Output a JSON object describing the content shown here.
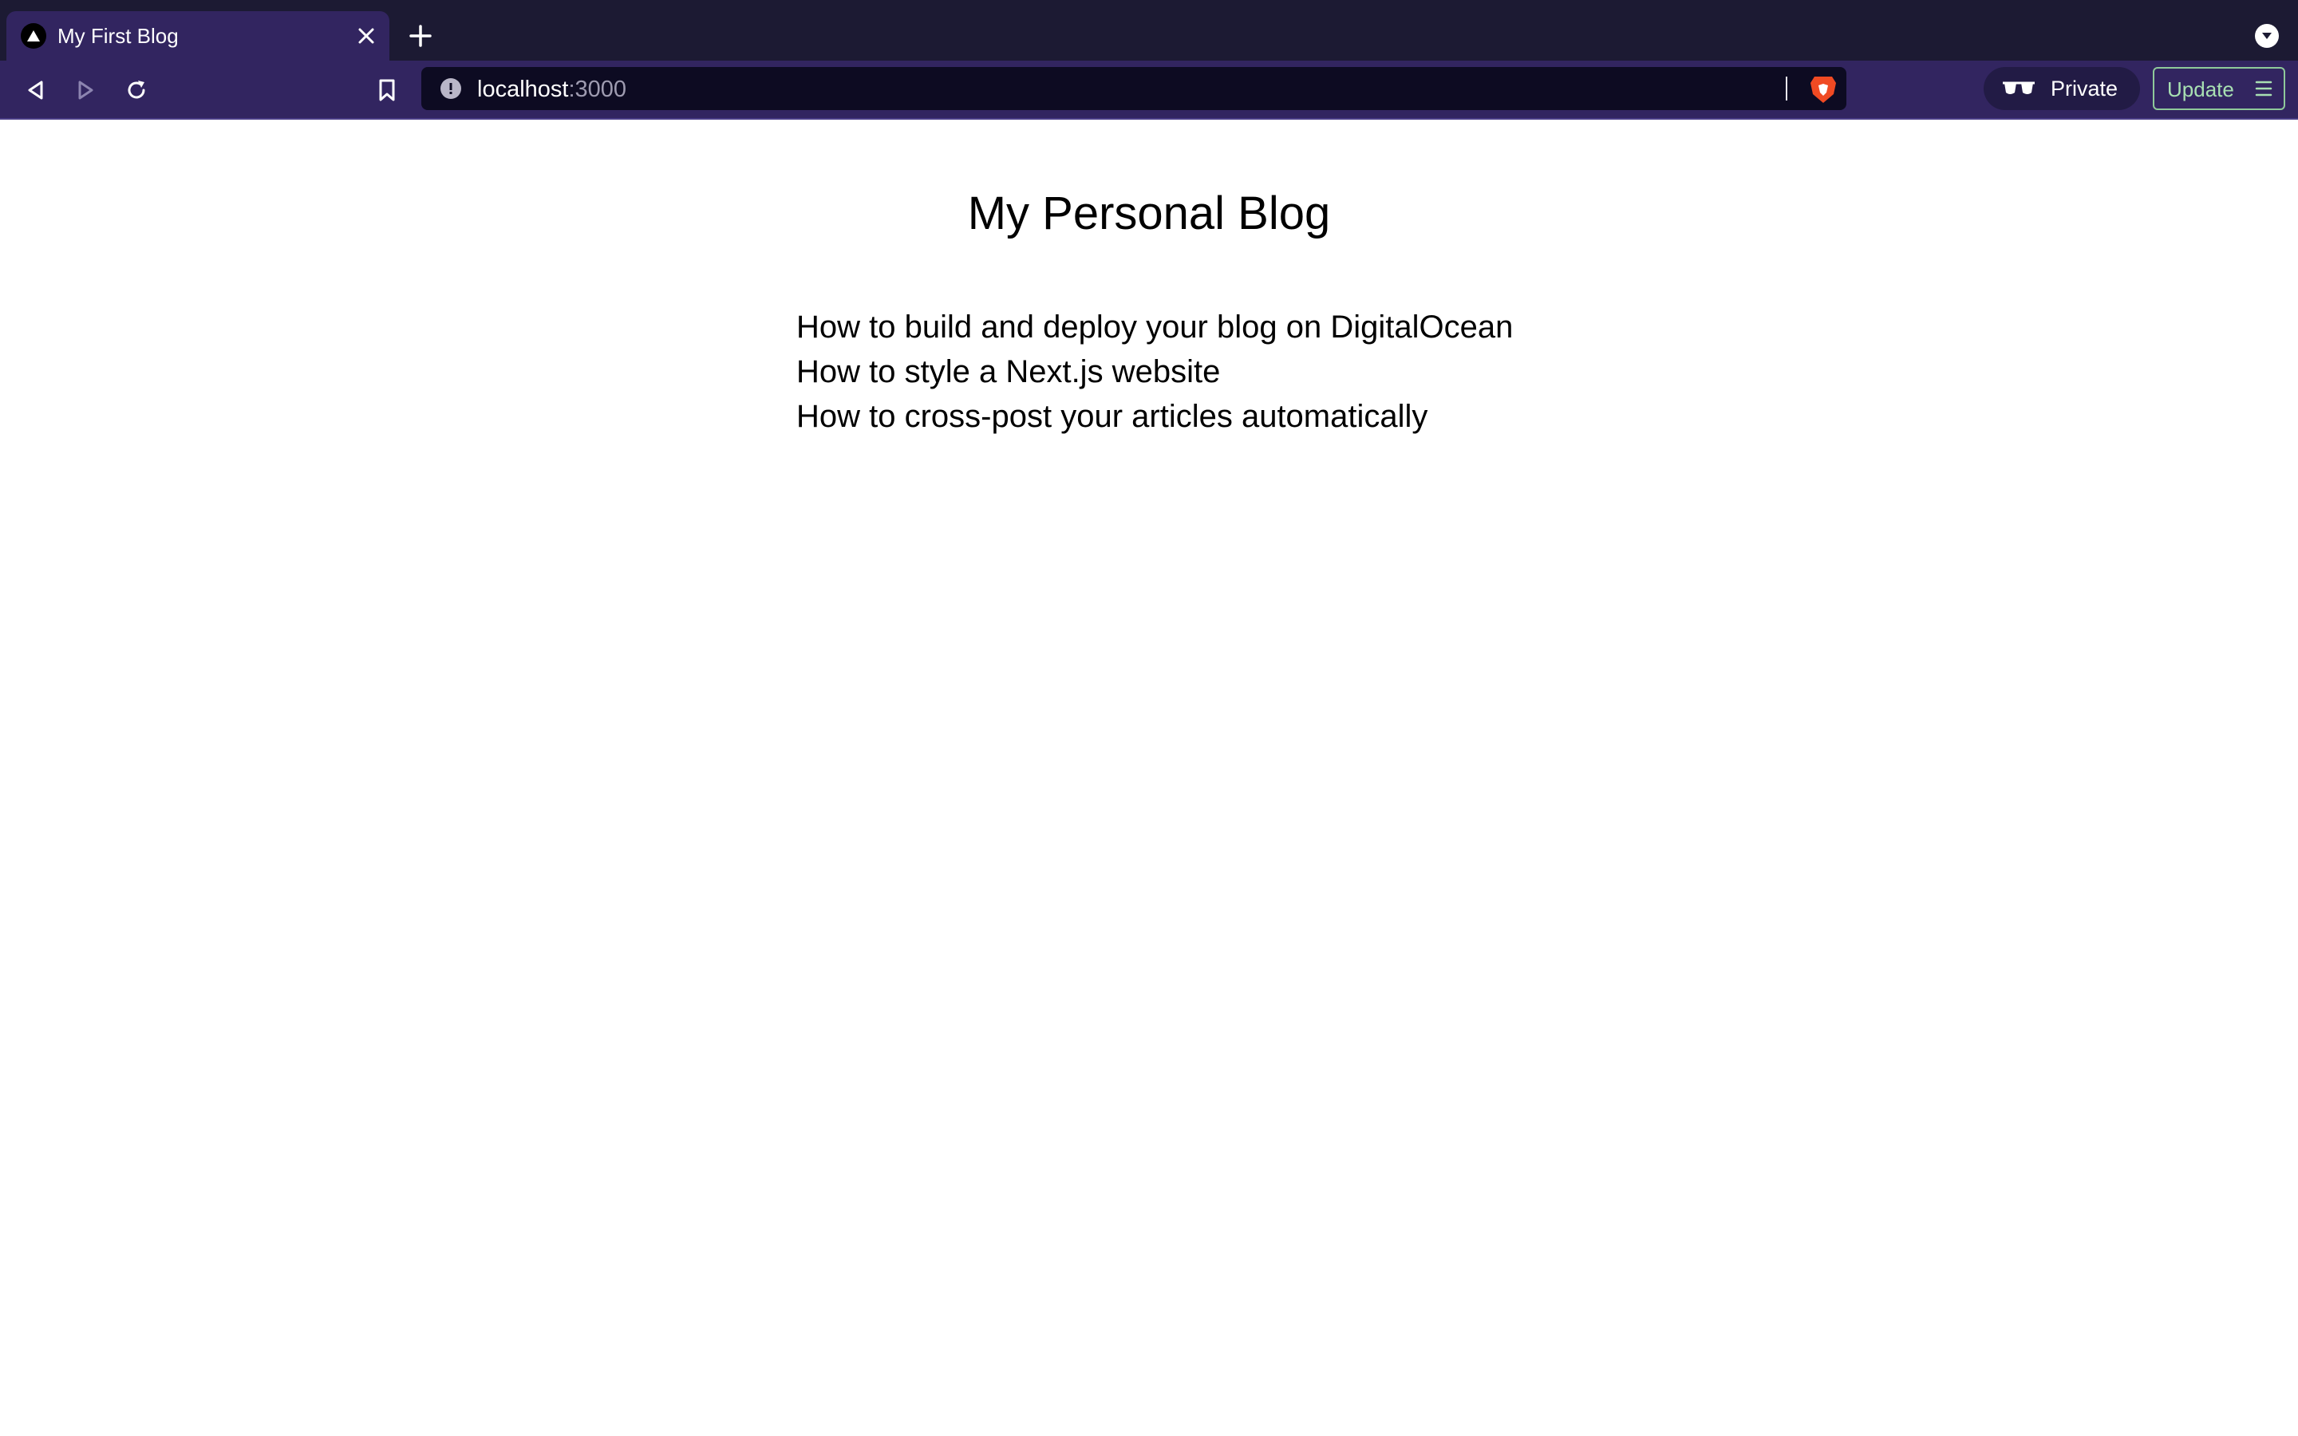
{
  "browser": {
    "tab": {
      "title": "My First Blog",
      "favicon": "nextjs-triangle-icon"
    },
    "address_bar": {
      "host": "localhost",
      "port": ":3000"
    },
    "private_label": "Private",
    "update_label": "Update",
    "colors": {
      "tabstrip": "#1c1a33",
      "toolbar": "#322560",
      "address_bar": "#0d0b22",
      "update_accent": "#8fc99a"
    },
    "icons": [
      "back-icon",
      "forward-icon",
      "reload-icon",
      "bookmark-icon",
      "info-icon",
      "brave-shield-icon",
      "private-glasses-icon",
      "hamburger-icon",
      "close-icon",
      "plus-icon",
      "chevron-down-icon"
    ]
  },
  "page": {
    "title": "My Personal Blog",
    "posts": [
      "How to build and deploy your blog on DigitalOcean",
      "How to style a Next.js website",
      "How to cross-post your articles automatically"
    ]
  }
}
